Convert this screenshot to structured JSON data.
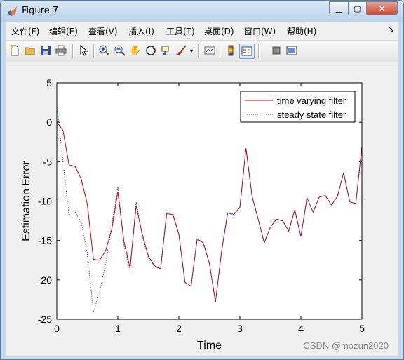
{
  "window": {
    "title": "Figure 7"
  },
  "menu": [
    "文件(F)",
    "编辑(E)",
    "查看(V)",
    "插入(I)",
    "工具(T)",
    "桌面(D)",
    "窗口(W)",
    "帮助(H)"
  ],
  "toolbar": [
    "new-figure",
    "open-file",
    "save",
    "print",
    "edit-plot",
    "zoom-in",
    "zoom-out",
    "pan",
    "rotate-3d",
    "data-cursor",
    "brush",
    "link-plot",
    "colorbar",
    "legend",
    "hide-plot-tools",
    "show-plot-tools"
  ],
  "watermark": "CSDN @mozun2020",
  "chart_data": {
    "type": "line",
    "xlabel": "Time",
    "ylabel": "Estimation Error",
    "xlim": [
      0,
      5
    ],
    "ylim": [
      -25,
      5
    ],
    "xticks": [
      "0",
      "1",
      "2",
      "3",
      "4",
      "5"
    ],
    "yticks": [
      "5",
      "0",
      "-5",
      "-10",
      "-15",
      "-20",
      "-25"
    ],
    "legend_position": "top-right",
    "series": [
      {
        "name": "time varying filter",
        "color": "#cc0000",
        "style": "solid",
        "x": [
          0,
          0.1,
          0.2,
          0.3,
          0.4,
          0.5,
          0.6,
          0.7,
          0.8,
          0.9,
          1.0,
          1.1,
          1.2,
          1.3,
          1.4,
          1.5,
          1.6,
          1.7,
          1.8,
          1.9,
          2.0,
          2.1,
          2.2,
          2.3,
          2.4,
          2.5,
          2.6,
          2.7,
          2.8,
          2.9,
          3.0,
          3.1,
          3.2,
          3.3,
          3.4,
          3.5,
          3.6,
          3.7,
          3.8,
          3.9,
          4.0,
          4.1,
          4.2,
          4.3,
          4.4,
          4.5,
          4.6,
          4.7,
          4.8,
          4.9,
          5.0
        ],
        "y": [
          0,
          -1,
          -5.4,
          -5.6,
          -7.2,
          -10.4,
          -17.4,
          -17.5,
          -16.3,
          -13.6,
          -8.8,
          -15.1,
          -18.5,
          -10.6,
          -14.2,
          -17,
          -18.2,
          -18.6,
          -11.6,
          -11.7,
          -14.2,
          -20.3,
          -20.8,
          -14.8,
          -15.3,
          -17.9,
          -22.8,
          -16.4,
          -11.5,
          -11.7,
          -10.8,
          -3.3,
          -9.4,
          -12.3,
          -15.3,
          -13.3,
          -12.3,
          -12.5,
          -13.8,
          -11.1,
          -14.5,
          -9.6,
          -11.4,
          -9.5,
          -9.3,
          -10.5,
          -9.4,
          -6.4,
          -10.1,
          -10.3,
          -3
        ]
      },
      {
        "name": "steady state filter",
        "color": "#2222cc",
        "style": "dotted",
        "x": [
          0,
          0.1,
          0.2,
          0.3,
          0.4,
          0.5,
          0.6,
          0.7,
          0.8,
          0.9,
          1.0,
          1.1,
          1.2,
          1.3,
          1.4,
          1.5,
          1.6,
          1.7,
          1.8,
          1.9,
          2.0,
          2.1,
          2.2,
          2.3,
          2.4,
          2.5,
          2.6,
          2.7,
          2.8,
          2.9,
          3.0,
          3.1,
          3.2,
          3.3,
          3.4,
          3.5,
          3.6,
          3.7,
          3.8,
          3.9,
          4.0,
          4.1,
          4.2,
          4.3,
          4.4,
          4.5,
          4.6,
          4.7,
          4.8,
          4.9,
          5.0
        ],
        "y": [
          2.2,
          -5,
          -11.8,
          -11.4,
          -12.7,
          -16.6,
          -24.1,
          -21.5,
          -18,
          -13,
          -8.2,
          -15.6,
          -18.8,
          -10.1,
          -14.4,
          -17.2,
          -18.3,
          -18.7,
          -11.4,
          -11.5,
          -14.2,
          -20.3,
          -20.8,
          -14.8,
          -15.3,
          -17.9,
          -22.8,
          -16.4,
          -11.5,
          -11.7,
          -10.8,
          -3.3,
          -9.4,
          -12.3,
          -15.3,
          -13.3,
          -12.3,
          -12.5,
          -13.8,
          -11.1,
          -14.5,
          -9.6,
          -11.4,
          -9.5,
          -9.3,
          -10.5,
          -9.4,
          -6.4,
          -10.1,
          -10.3,
          -3.2
        ]
      }
    ]
  }
}
